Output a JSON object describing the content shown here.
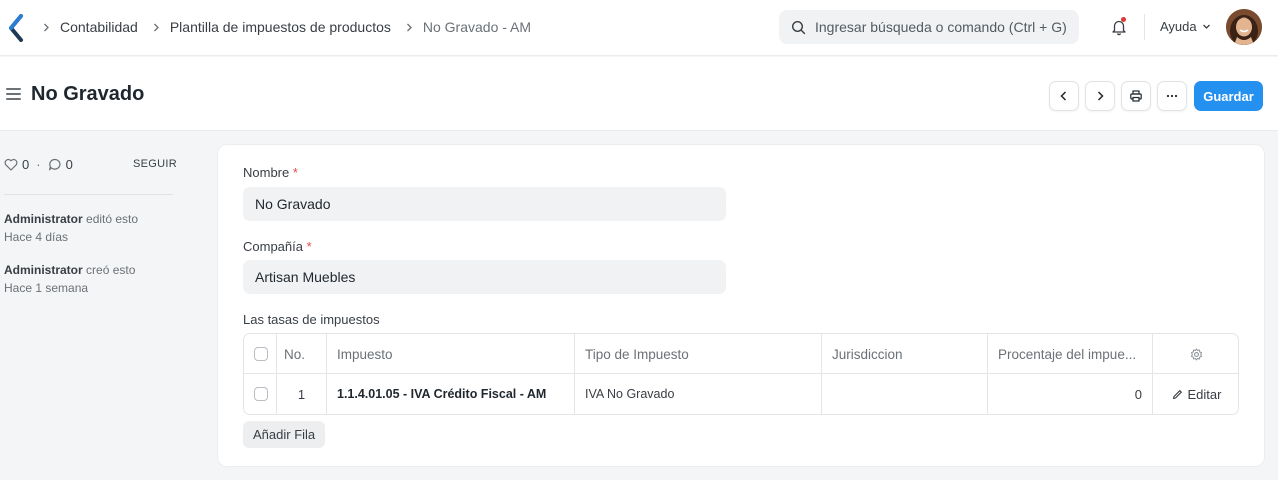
{
  "breadcrumb": [
    {
      "label": "Contabilidad"
    },
    {
      "label": "Plantilla de impuestos de productos"
    },
    {
      "label": "No Gravado - AM"
    }
  ],
  "search": {
    "placeholder": "Ingresar búsqueda o comando (Ctrl + G)"
  },
  "navbar": {
    "help_label": "Ayuda"
  },
  "page": {
    "title": "No Gravado",
    "save_label": "Guardar"
  },
  "sidebar": {
    "likes": "0",
    "comments": "0",
    "dot": "·",
    "follow_label": "SEGUIR",
    "activity": [
      {
        "user": "Administrator",
        "action": " editó esto",
        "time": "Hace 4 días"
      },
      {
        "user": "Administrator",
        "action": " creó esto",
        "time": "Hace 1 semana"
      }
    ]
  },
  "form": {
    "nombre_label": "Nombre",
    "nombre_value": "No Gravado",
    "compania_label": "Compañía",
    "compania_value": "Artisan Muebles",
    "required_mark": "*",
    "taxes_label": "Las tasas de impuestos",
    "table": {
      "columns": [
        "No.",
        "Impuesto",
        "Tipo de Impuesto",
        "Jurisdiccion",
        "Procentaje del impue..."
      ],
      "rows": [
        {
          "no": "1",
          "impuesto": "1.1.4.01.05 - IVA Crédito Fiscal - AM",
          "tipo": "IVA No Gravado",
          "jurisdiccion": "",
          "porcentaje": "0",
          "edit_label": "Editar"
        }
      ]
    },
    "add_row_label": "Añadir Fila"
  },
  "colors": {
    "primary": "#2490ef",
    "required": "#e24c4c",
    "background": "#f4f5f6"
  }
}
